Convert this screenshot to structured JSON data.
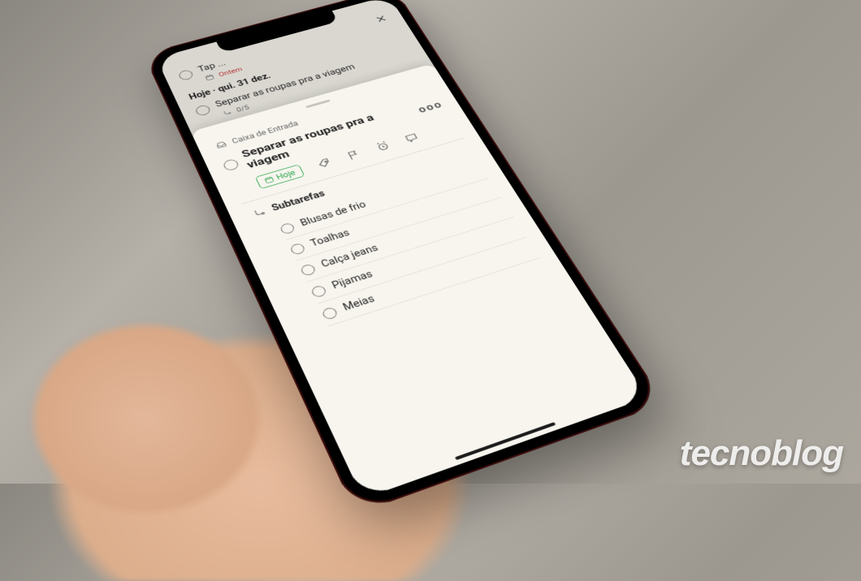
{
  "bg": {
    "row0_title": "Tap ...",
    "row0_date_label": "Ontem",
    "section_date": "Hoje · qui. 31 dez.",
    "row1_title": "Separar as roupas pra a viagem",
    "row1_count": "0/5"
  },
  "panel": {
    "crumb": "Caixa de Entrada",
    "title": "Separar as roupas pra a viagem",
    "more": "ooo",
    "date_chip": "Hoje",
    "subtasks_heading": "Subtarefas",
    "items": {
      "i0": "Blusas de frio",
      "i1": "Toalhas",
      "i2": "Calça jeans",
      "i3": "Pijamas",
      "i4": "Meias"
    }
  },
  "watermark": "tecnoblog"
}
